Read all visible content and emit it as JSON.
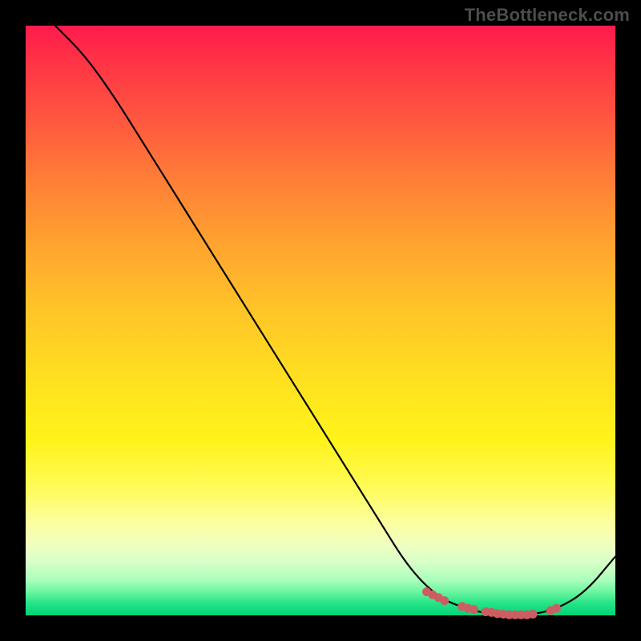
{
  "watermark": "TheBottleneck.com",
  "colors": {
    "frame": "#000000",
    "gradient_top": "#ff1a4d",
    "gradient_bottom": "#00d478",
    "line": "#000000",
    "marker": "#cc5e62"
  },
  "chart_data": {
    "type": "line",
    "title": "",
    "xlabel": "",
    "ylabel": "",
    "xlim": [
      0,
      100
    ],
    "ylim": [
      0,
      100
    ],
    "grid": false,
    "legend": false,
    "series": [
      {
        "name": "bottleneck-curve",
        "x": [
          5,
          10,
          15,
          20,
          25,
          30,
          35,
          40,
          45,
          50,
          55,
          60,
          65,
          70,
          75,
          80,
          85,
          90,
          95,
          100
        ],
        "y": [
          100,
          95,
          88,
          80,
          72,
          64,
          56,
          48,
          40,
          32,
          24,
          16,
          8,
          3,
          1,
          0,
          0,
          1,
          4,
          10
        ]
      }
    ],
    "markers": {
      "name": "highlighted-range",
      "x": [
        68,
        69,
        70,
        71,
        74,
        75,
        76,
        78,
        79,
        80,
        81,
        82,
        83,
        84,
        85,
        86,
        89,
        90
      ],
      "y": [
        4,
        3.5,
        3,
        2.5,
        1.5,
        1.2,
        1.0,
        0.6,
        0.5,
        0.3,
        0.2,
        0.1,
        0.1,
        0.1,
        0.1,
        0.2,
        0.8,
        1.2
      ]
    }
  }
}
